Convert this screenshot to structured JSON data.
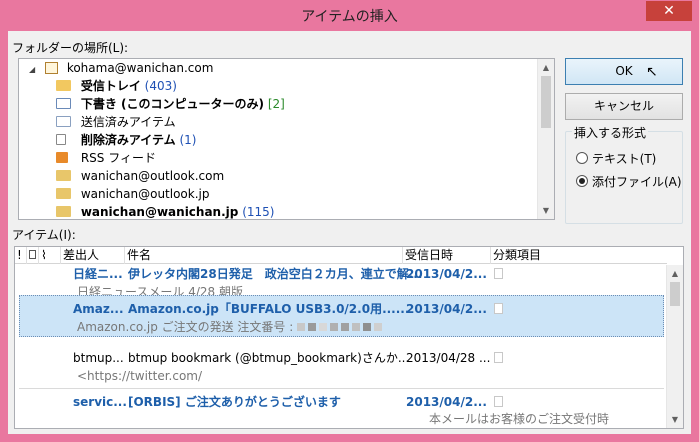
{
  "window": {
    "title": "アイテムの挿入",
    "close_glyph": "✕"
  },
  "folder_label": "フォルダーの場所(L):",
  "tree": {
    "account": "kohama@wanichan.com",
    "items": [
      {
        "label": "受信トレイ",
        "count": "(403)",
        "bold": true,
        "icon": "inbox-icon"
      },
      {
        "label": "下書き (このコンピューターのみ)",
        "count": "[2]",
        "bold": true,
        "icon": "draft-icon"
      },
      {
        "label": "送信済みアイテム",
        "count": "",
        "bold": false,
        "icon": "sent-icon"
      },
      {
        "label": "削除済みアイテム",
        "count": "(1)",
        "bold": true,
        "icon": "trash-icon"
      },
      {
        "label": "RSS フィード",
        "count": "",
        "bold": false,
        "icon": "rss-icon"
      },
      {
        "label": "wanichan@outlook.com",
        "count": "",
        "bold": false,
        "icon": "folder-icon"
      },
      {
        "label": "wanichan@outlook.jp",
        "count": "",
        "bold": false,
        "icon": "folder-icon"
      },
      {
        "label": "wanichan@wanichan.jp",
        "count": "(115)",
        "bold": true,
        "icon": "folder-icon"
      }
    ]
  },
  "buttons": {
    "ok": "OK",
    "cancel": "キャンセル"
  },
  "insert_format": {
    "label": "挿入する形式",
    "options": [
      {
        "label": "テキスト(T)",
        "selected": false
      },
      {
        "label": "添付ファイル(A)",
        "selected": true
      }
    ]
  },
  "items_label": "アイテム(I):",
  "columns": {
    "importance": "!",
    "icon": "",
    "attachment": "",
    "from": "差出人",
    "subject": "件名",
    "received": "受信日時",
    "category": "分類項目"
  },
  "messages": [
    {
      "from": "日経ニ...",
      "subject": "伊レッタ内閣28日発足　政治空白２カ月、連立で解...",
      "received": "2013/04/2...",
      "preview": "日経ニュースメール  4/28  朝版",
      "unread": true
    },
    {
      "from": "Amaz...",
      "subject": "Amazon.co.jp「BUFFALO USB3.0/2.0用......",
      "received": "2013/04/2...",
      "preview": "Amazon.co.jp  ご注文の発送  注文番号 :",
      "unread": true
    },
    {
      "from": "btmup...",
      "subject": "btmup bookmark (@btmup_bookmark)さんか...",
      "received": "2013/04/28 ...",
      "preview": "<https://twitter.com/",
      "unread": false
    },
    {
      "from": "servic...",
      "subject": "[ORBIS] ご注文ありがとうございます",
      "received": "2013/04/2...",
      "preview": "本メールはお客様のご注文受付時",
      "unread": true
    }
  ]
}
